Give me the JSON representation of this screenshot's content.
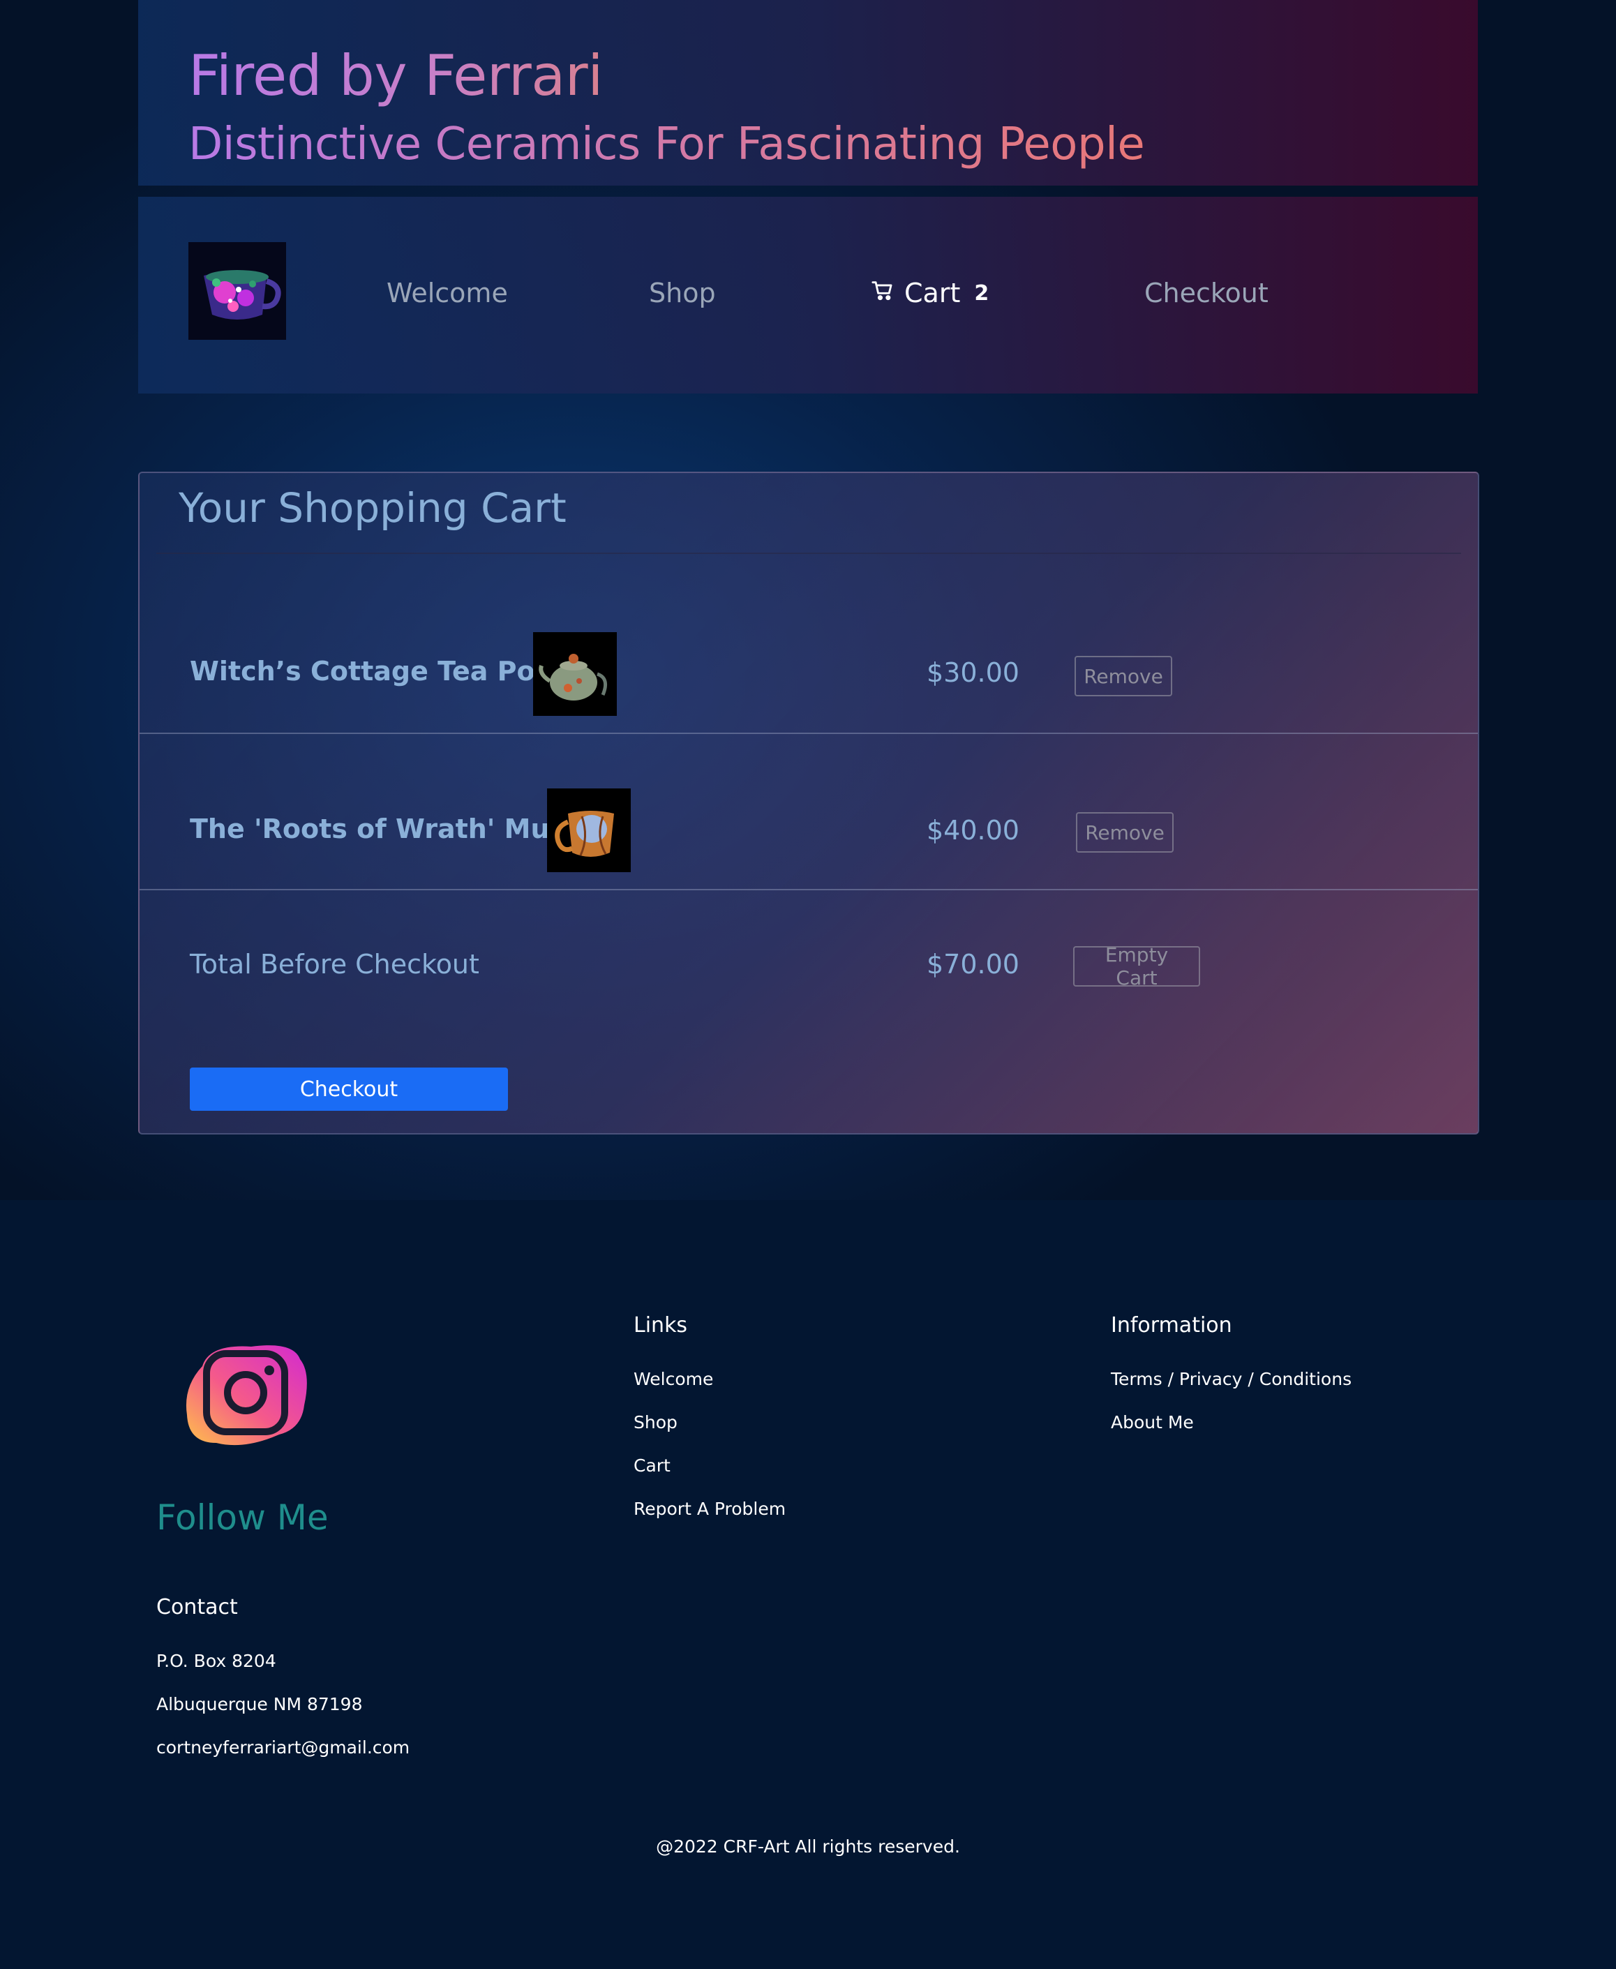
{
  "header": {
    "title": "Fired by Ferrari",
    "subtitle": "Distinctive Ceramics For Fascinating People"
  },
  "nav": {
    "items": [
      {
        "label": "Welcome"
      },
      {
        "label": "Shop"
      },
      {
        "label": "Cart",
        "count": "2"
      },
      {
        "label": "Checkout"
      }
    ]
  },
  "cart": {
    "heading": "Your Shopping Cart",
    "items": [
      {
        "name": "Witch’s Cottage Tea Pot",
        "price": "$30.00",
        "remove_label": "Remove"
      },
      {
        "name": "The 'Roots of Wrath' Mug",
        "price": "$40.00",
        "remove_label": "Remove"
      }
    ],
    "total_label": "Total Before Checkout",
    "total_price": "$70.00",
    "empty_label": "Empty Cart",
    "checkout_label": "Checkout"
  },
  "footer": {
    "follow_label": "Follow Me",
    "contact": {
      "title": "Contact",
      "lines": [
        "P.O. Box 8204",
        "Albuquerque NM 87198",
        "cortneyferrariart@gmail.com"
      ]
    },
    "links": {
      "title": "Links",
      "items": [
        "Welcome",
        "Shop",
        "Cart",
        "Report A Problem"
      ]
    },
    "information": {
      "title": "Information",
      "items": [
        "Terms / Privacy / Conditions",
        "About Me"
      ]
    },
    "copyright": "@2022 CRF-Art All rights reserved."
  },
  "colors": {
    "accent_button": "#1a6cf5",
    "text_blue": "#8ab0d8",
    "follow_teal": "#1f8e8c",
    "footer_bg": "#031631"
  },
  "icons": [
    "cart-icon",
    "instagram-icon",
    "mug-logo-icon"
  ]
}
